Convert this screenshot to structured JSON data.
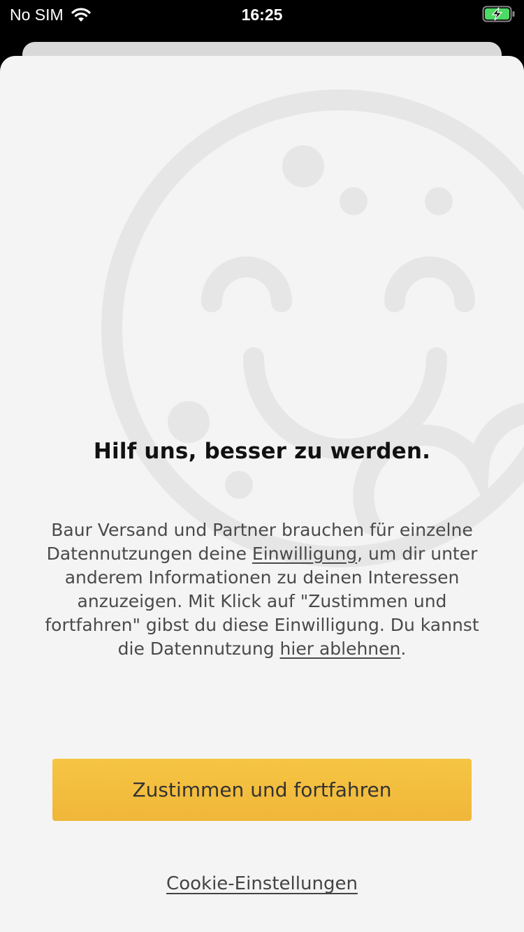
{
  "status_bar": {
    "carrier": "No SIM",
    "time": "16:25",
    "wifi_icon": "wifi-icon",
    "battery_icon": "battery-charging-icon",
    "battery_color": "#4cd964"
  },
  "dialog": {
    "illustration_icon": "smiling-cookie-icon",
    "title": "Hilf uns, besser zu werden.",
    "body": {
      "part1": "Baur Versand und Partner brauchen für einzelne Datennutzungen deine ",
      "link1": "Einwilligung",
      "part2": ", um dir unter anderem Informationen zu deinen Interessen anzuzeigen. Mit Klick auf \"Zustimmen und fortfahren\" gibst du diese Einwilligung. Du kannst die Datennutzung ",
      "link2": "hier ablehnen",
      "part3": "."
    },
    "accept_button": "Zustimmen und fortfahren",
    "settings_link": "Cookie-Einstellungen",
    "accent_color": "#f3bf3f"
  }
}
